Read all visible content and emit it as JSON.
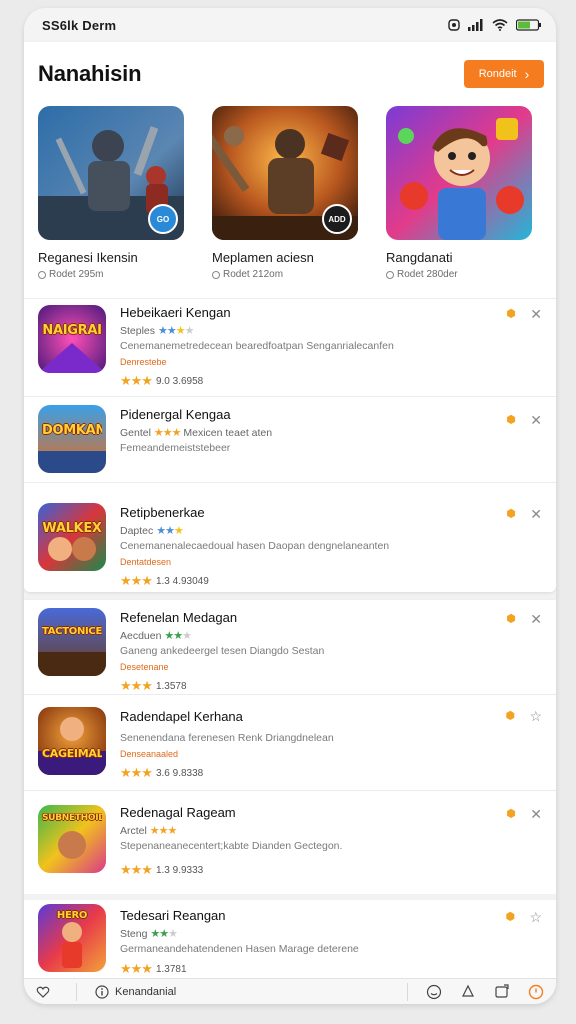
{
  "status_bar": {
    "time": "SS6lk Derm"
  },
  "header": {
    "title": "Nanahisin",
    "button_label": "Rondeit"
  },
  "featured": [
    {
      "title": "Reganesi Ikensin",
      "subtitle": "Rodet 295m",
      "badge": "GO"
    },
    {
      "title": "Meplamen aciesn",
      "subtitle": "Rodet 212om",
      "badge": "ADD"
    },
    {
      "title": "Rangdanati",
      "subtitle": "Rodet 280der",
      "badge": ""
    }
  ],
  "list_top": [
    {
      "title": "Hebeikaeri Kengan",
      "subtitle": "Steples",
      "desc": "Cenemanemetredecean bearedfoatpan Senganrialecanfen",
      "tag": "Denrestebe",
      "rating_text": "9.0 3.6958",
      "icon_word": "NAIGRAI"
    },
    {
      "title": "Pidenergal Kengaa",
      "subtitle": "Gentel",
      "desc": "Mexicen teaet aten",
      "tag": "",
      "rating_text": "",
      "extra_desc": "Femeandemeiststebeer",
      "icon_word": "DOMKAN"
    },
    {
      "title": "Retipbenerkae",
      "subtitle": "Daptec",
      "desc": "Cenemanenalecaedoual hasen Daopan dengnelaneanten",
      "tag": "Dentatdesen",
      "rating_text": "1.3 4.93049",
      "icon_word": "WALKEX"
    }
  ],
  "list_bottom": [
    {
      "title": "Refenelan Medagan",
      "subtitle": "Aecduen",
      "desc": "Ganeng ankedeergel tesen Diangdo Sestan",
      "tag": "Desetenane",
      "rating_text": "1.3578",
      "icon_word": "TACTONICE"
    },
    {
      "title": "Radendapel Kerhana",
      "subtitle": "",
      "desc": "Senenendana ferenesen Renk Driangdnelean",
      "tag": "Denseanaaled",
      "rating_text": "3.6 9.8338",
      "icon_word": "CAGEIMAL"
    },
    {
      "title": "Redenagal Rageam",
      "subtitle": "Arctel",
      "desc": "Stepenaneanecentert;kabte Dianden Gectegon.",
      "tag": "",
      "rating_text": "1.3 9.9333",
      "icon_word": "SUBNETHOID"
    },
    {
      "title": "Tedesari Reangan",
      "subtitle": "Steng",
      "desc": "Germaneandehatendenen Hasen Marage deterene",
      "tag": "",
      "rating_text": "1.3781",
      "icon_word": "HERO"
    }
  ],
  "bottom_nav": {
    "left_label": "Kenandanial"
  },
  "colors": {
    "accent": "#f57c1f",
    "star": "#f2a321"
  }
}
